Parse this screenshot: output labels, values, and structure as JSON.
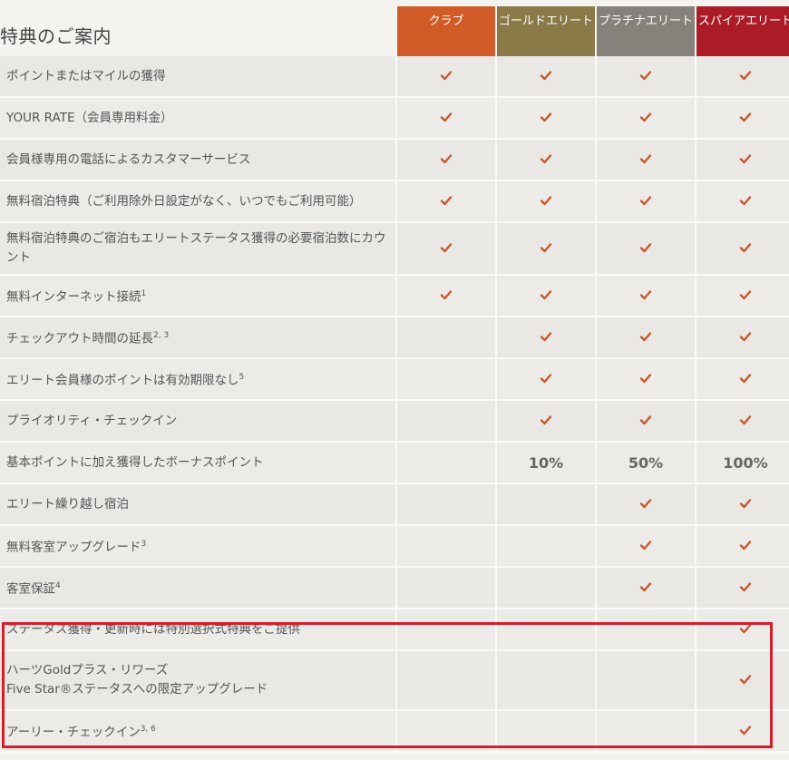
{
  "page": {
    "title": "特典のご案内"
  },
  "tiers": [
    {
      "label": "クラブ",
      "color": "#d05b27"
    },
    {
      "label": "ゴールドエリート",
      "color": "#8a7a47"
    },
    {
      "label": "プラチナエリート",
      "color": "#86827b"
    },
    {
      "label": "スパイアエリート",
      "color": "#ab1c27"
    }
  ],
  "accent_check_color": "#c7582e",
  "rows": [
    {
      "label": "ポイントまたはマイルの獲得",
      "sup": "",
      "cells": [
        "check",
        "check",
        "check",
        "check"
      ]
    },
    {
      "label": "YOUR RATE（会員専用料金）",
      "sup": "",
      "cells": [
        "check",
        "check",
        "check",
        "check"
      ]
    },
    {
      "label": "会員様専用の電話によるカスタマーサービス",
      "sup": "",
      "cells": [
        "check",
        "check",
        "check",
        "check"
      ]
    },
    {
      "label": "無料宿泊特典（ご利用除外日設定がなく、いつでもご利用可能）",
      "sup": "",
      "cells": [
        "check",
        "check",
        "check",
        "check"
      ]
    },
    {
      "label": "無料宿泊特典のご宿泊もエリートステータス獲得の必要宿泊数にカウント",
      "sup": "",
      "cells": [
        "check",
        "check",
        "check",
        "check"
      ]
    },
    {
      "label": "無料インターネット接続",
      "sup": "1",
      "cells": [
        "check",
        "check",
        "check",
        "check"
      ]
    },
    {
      "label": "チェックアウト時間の延長",
      "sup": "2, 3",
      "cells": [
        "",
        "check",
        "check",
        "check"
      ]
    },
    {
      "label": "エリート会員様のポイントは有効期限なし",
      "sup": "5",
      "cells": [
        "",
        "check",
        "check",
        "check"
      ]
    },
    {
      "label": "プライオリティ・チェックイン",
      "sup": "",
      "cells": [
        "",
        "check",
        "check",
        "check"
      ]
    },
    {
      "label": "基本ポイントに加え獲得したボーナスポイント",
      "sup": "",
      "cells": [
        "",
        "10%",
        "50%",
        "100%"
      ]
    },
    {
      "label": "エリート繰り越し宿泊",
      "sup": "",
      "cells": [
        "",
        "",
        "check",
        "check"
      ]
    },
    {
      "label": "無料客室アップグレード",
      "sup": "3",
      "cells": [
        "",
        "",
        "check",
        "check"
      ]
    },
    {
      "label": "客室保証",
      "sup": "4",
      "cells": [
        "",
        "",
        "check",
        "check"
      ]
    },
    {
      "label": "ステータス獲得・更新時には特別選択式特典をご提供",
      "sup": "",
      "cells": [
        "",
        "",
        "",
        "check"
      ]
    },
    {
      "label": "ハーツGoldプラス・リワーズ\nFive Star®ステータスへの限定アップグレード",
      "sup": "",
      "cells": [
        "",
        "",
        "",
        "check"
      ]
    },
    {
      "label": "アーリー・チェックイン",
      "sup": "3, 6",
      "cells": [
        "",
        "",
        "",
        "check"
      ]
    }
  ]
}
